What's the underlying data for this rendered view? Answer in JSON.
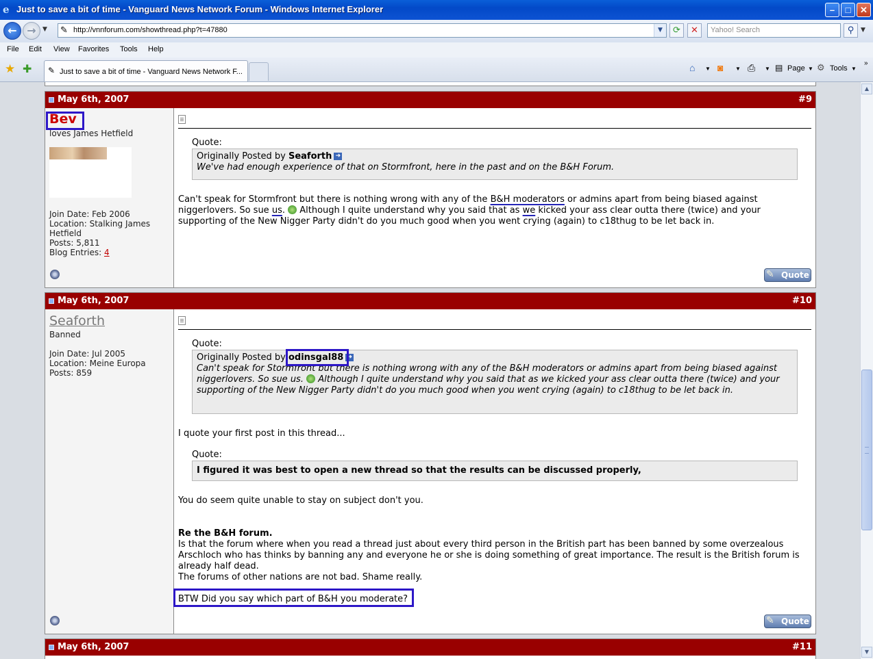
{
  "window": {
    "title": "Just to save a bit of time - Vanguard News Network Forum - Windows Internet Explorer",
    "min_glyph": "–",
    "max_glyph": "□",
    "close_glyph": "✕"
  },
  "address": {
    "url": "http://vnnforum.com/showthread.php?t=47880"
  },
  "search": {
    "placeholder": "Yahoo! Search"
  },
  "menu": [
    "File",
    "Edit",
    "View",
    "Favorites",
    "Tools",
    "Help"
  ],
  "tab": {
    "label": "Just to save a bit of time - Vanguard News Network F..."
  },
  "toolbar": {
    "page_label": "Page",
    "tools_label": "Tools"
  },
  "posts": [
    {
      "date": "May 6th, 2007",
      "number": "#9",
      "username": "Bev",
      "user_title": "loves James Hetfield",
      "join": "Join Date: Feb 2006",
      "location_1": "Location: Stalking James",
      "location_2": "Hetfield",
      "posts": "Posts: 5,811",
      "blog_label": "Blog Entries: ",
      "blog_count": "4",
      "quote_label": "Quote:",
      "quote_orig_prefix": "Originally Posted by ",
      "quote_author": "Seaforth",
      "quote_text": "We've had enough experience of that on Stormfront, here in the past and on the B&H Forum.",
      "body_1": "Can't speak for Stormfront but there is nothing wrong with any of the ",
      "body_u1": "B&H moderators",
      "body_2": " or admins apart from being biased against niggerlovers. So sue ",
      "body_u2": "us",
      "body_3": ". ",
      "body_4": " Although I quite understand why you said that as ",
      "body_u3": "we",
      "body_5": " kicked your ass clear outta there (twice) and your supporting of the New Nigger Party didn't do you much good when you went crying (again) to c18thug to be let back in.",
      "quote_button": "Quote"
    },
    {
      "date": "May 6th, 2007",
      "number": "#10",
      "username": "Seaforth",
      "user_title": "Banned",
      "join": "Join Date: Jul 2005",
      "location": "Location: Meine Europa",
      "posts": "Posts: 859",
      "quote_label": "Quote:",
      "quote_orig_prefix": "Originally Posted by ",
      "quote_author": "odinsgal88",
      "quote_text_1": "Can't speak for Stormfront but there is nothing wrong with any of the B&H moderators or admins apart from being biased against niggerlovers. So sue us. ",
      "quote_text_2": " Although I quite understand why you said that as we kicked your ass clear outta there (twice) and your supporting of the New Nigger Party didn't do you much good when you went crying (again) to c18thug to be let back in.",
      "line_1": "I quote your first post in this thread...",
      "quote2_label": "Quote:",
      "quote2_text": "I figured it was best to open a new thread so that the results can be discussed properly,",
      "line_2": "You do seem quite unable to stay on subject don't you.",
      "heading": "Re the B&H forum.",
      "para": "Is that the forum where when you read a thread just about every third person in the British part has been banned by some overzealous Arschloch who has thinks by banning any and everyone he or she is doing something of great importance. The result is the British forum is already half dead.",
      "para_2": "The forums of other nations are not bad. Shame really.",
      "last_line": "BTW Did you say which part of B&H you moderate?",
      "quote_button": "Quote"
    },
    {
      "date": "May 6th, 2007",
      "number": "#11"
    }
  ],
  "colors": {
    "post_header": "#990000",
    "highlight_box": "#2d17c7",
    "username_bev": "#cc0000"
  }
}
